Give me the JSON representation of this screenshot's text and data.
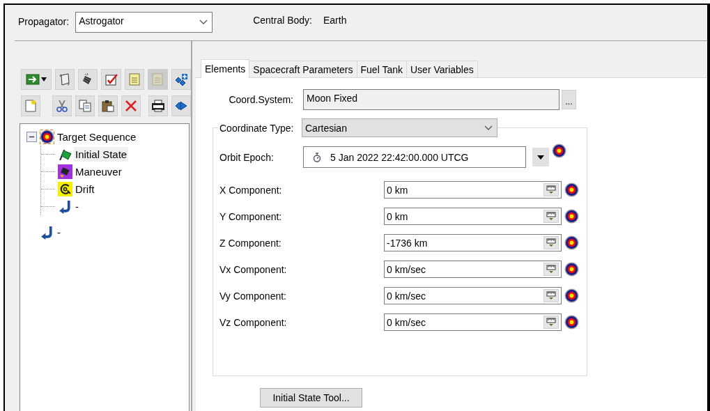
{
  "header": {
    "propagator_label": "Propagator:",
    "propagator": "Astrogator",
    "central_body_label": "Central Body:",
    "central_body": "Earth"
  },
  "toolbar_rows": [
    {
      "buttons": [
        {
          "kind": "run",
          "disabled": false
        },
        {
          "kind": "scroll",
          "disabled": false
        },
        {
          "kind": "engine",
          "disabled": false
        },
        {
          "kind": "checkbox",
          "disabled": false
        },
        {
          "kind": "document",
          "disabled": false
        },
        {
          "kind": "document",
          "disabled": true
        },
        {
          "kind": "cubes_plus",
          "disabled": false
        }
      ]
    },
    {
      "buttons": [
        {
          "kind": "new_document",
          "disabled": false
        },
        {
          "kind": "cut",
          "disabled": false
        },
        {
          "kind": "copy",
          "disabled": false
        },
        {
          "kind": "paste",
          "disabled": false
        },
        {
          "kind": "delete",
          "disabled": false
        },
        {
          "kind": "printer",
          "disabled": false
        },
        {
          "kind": "cubes_arrow",
          "disabled": false
        }
      ]
    }
  ],
  "tree": [
    {
      "label": "Target Sequence",
      "kind": "target",
      "selected": false,
      "expanded": true,
      "children": [
        {
          "label": "Initial State",
          "kind": "initial",
          "selected": true
        },
        {
          "label": "Maneuver",
          "kind": "maneuver",
          "selected": false
        },
        {
          "label": "Drift",
          "kind": "drift",
          "selected": false
        },
        {
          "label": "-",
          "kind": "return",
          "selected": false
        }
      ]
    },
    {
      "label": "-",
      "kind": "return",
      "selected": false
    }
  ],
  "tabs": [
    {
      "label": "Elements",
      "selected": true
    },
    {
      "label": "Spacecraft Parameters",
      "selected": false
    },
    {
      "label": "Fuel Tank",
      "selected": false
    },
    {
      "label": "User Variables",
      "selected": false
    }
  ],
  "elements": {
    "coord_system": {
      "label": "Coord.System:",
      "value": "Moon Fixed",
      "button": "..."
    },
    "coordinate_type": {
      "label": "Coordinate Type:",
      "value": "Cartesian"
    },
    "orbit_epoch": {
      "label": "Orbit Epoch:",
      "value": "5 Jan 2022 22:42:00.000 UTCG"
    },
    "components": [
      {
        "label": "X Component:",
        "value": "0 km"
      },
      {
        "label": "Y Component:",
        "value": "0 km"
      },
      {
        "label": "Z Component:",
        "value": "-1736 km"
      },
      {
        "label": "Vx Component:",
        "value": "0 km/sec"
      },
      {
        "label": "Vy Component:",
        "value": "0 km/sec"
      },
      {
        "label": "Vz Component:",
        "value": "0 km/sec"
      }
    ],
    "tool_button": "Initial State Tool..."
  }
}
